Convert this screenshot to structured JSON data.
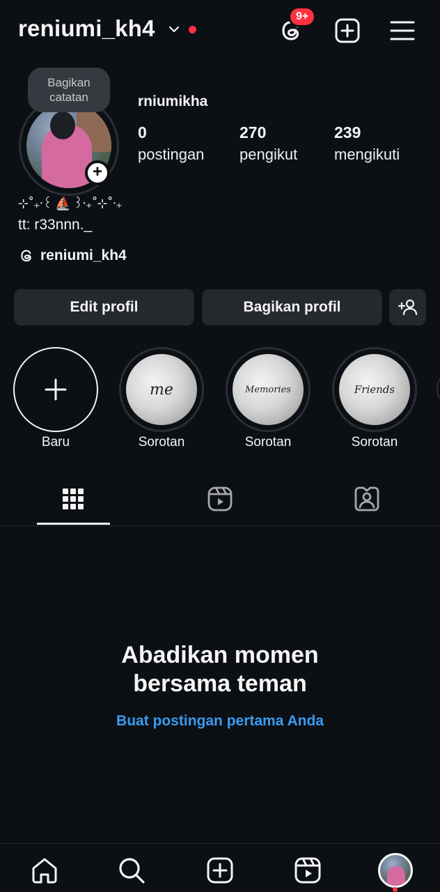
{
  "header": {
    "username": "reniumi_kh4",
    "notifications_badge": "9+",
    "accent_red": "#ff3040"
  },
  "profile": {
    "note": "Bagikan catatan",
    "display_name": "rniumikha",
    "stats": [
      {
        "value": "0",
        "label": "postingan"
      },
      {
        "value": "270",
        "label": "pengikut"
      },
      {
        "value": "239",
        "label": "mengikuti"
      }
    ],
    "bio_line1": "⊹˚₊‧꒰ ⛵ ꒱‧₊˚⊹˚‧₊",
    "bio_line2": "tt: r33nnn._",
    "threads_username": "reniumi_kh4"
  },
  "actions": {
    "edit_profile": "Edit profil",
    "share_profile": "Bagikan profil"
  },
  "highlights": {
    "new_label": "Baru",
    "items": [
      {
        "cover_text": "me",
        "label": "Sorotan"
      },
      {
        "cover_text": "Memories",
        "label": "Sorotan"
      },
      {
        "cover_text": "Friends",
        "label": "Sorotan"
      }
    ]
  },
  "tabs": [
    "grid-icon",
    "reels-icon",
    "tagged-icon"
  ],
  "empty_state": {
    "title_line1": "Abadikan momen",
    "title_line2": "bersama teman",
    "cta": "Buat postingan pertama Anda",
    "cta_color": "#3a9bf0"
  },
  "bottom_nav": [
    "home-icon",
    "search-icon",
    "create-icon",
    "reels-icon",
    "profile-avatar"
  ]
}
